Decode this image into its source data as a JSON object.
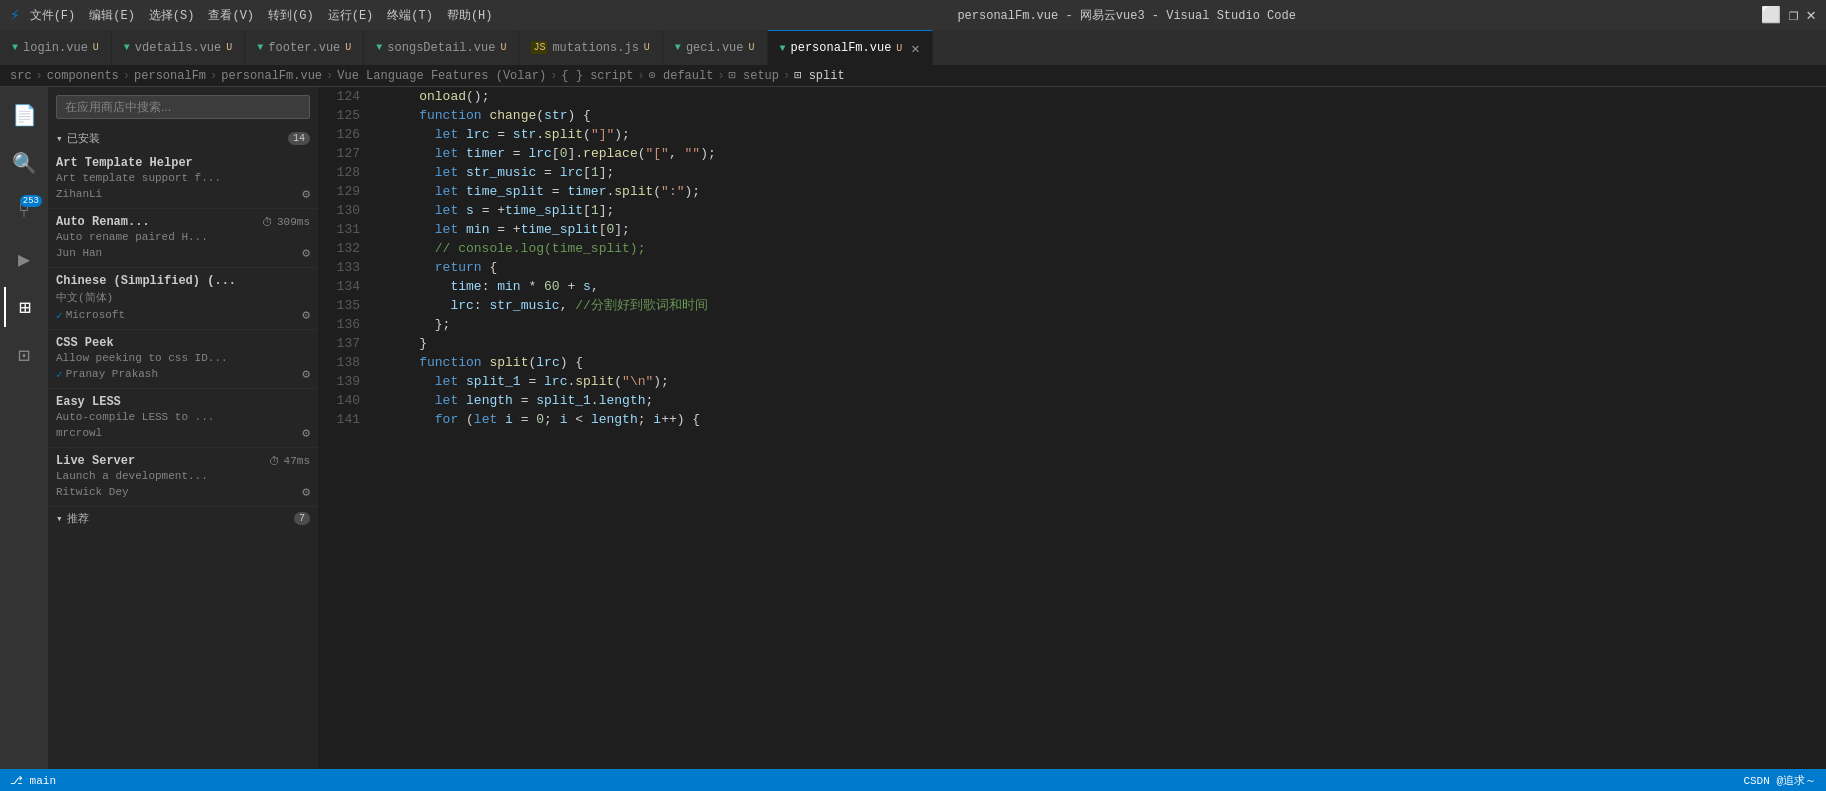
{
  "titleBar": {
    "logo": "⚡",
    "menus": [
      "文件(F)",
      "编辑(E)",
      "选择(S)",
      "查看(V)",
      "转到(G)",
      "运行(E)",
      "终端(T)",
      "帮助(H)"
    ],
    "title": "personalFm.vue - 网易云vue3 - Visual Studio Code",
    "windowControls": [
      "⬜",
      "❐",
      "✕"
    ]
  },
  "tabs": [
    {
      "id": "login",
      "label": "login.vue",
      "icon": "vue",
      "modified": true,
      "active": false
    },
    {
      "id": "vdetails",
      "label": "vdetails.vue",
      "icon": "vue",
      "modified": true,
      "active": false
    },
    {
      "id": "footer",
      "label": "footer.vue",
      "icon": "vue",
      "modified": true,
      "active": false
    },
    {
      "id": "songsDetail",
      "label": "songsDetail.vue",
      "icon": "vue",
      "modified": true,
      "active": false
    },
    {
      "id": "mutations",
      "label": "mutations.js",
      "icon": "js",
      "modified": true,
      "active": false
    },
    {
      "id": "geci",
      "label": "geci.vue",
      "icon": "vue",
      "modified": true,
      "active": false
    },
    {
      "id": "personalfm",
      "label": "personalFm.vue",
      "icon": "vue",
      "modified": true,
      "active": true
    }
  ],
  "breadcrumb": {
    "parts": [
      "src",
      "components",
      "personalFm",
      "personalFm.vue",
      "Vue Language Features (Volar)",
      "{ } script",
      "⊙ default",
      "⊡ setup",
      "⊡ split"
    ]
  },
  "sidebar": {
    "searchPlaceholder": "在应用商店中搜索...",
    "installedSection": {
      "label": "已安装",
      "count": "14"
    },
    "extensions": [
      {
        "id": "art-template",
        "name": "Art Template Helper",
        "desc": "Art template support f...",
        "author": "ZihanLi",
        "verified": false,
        "hasGear": true,
        "timer": null,
        "timerVal": null
      },
      {
        "id": "auto-rename",
        "name": "Auto Renam...",
        "desc": "Auto rename paired H...",
        "author": "Jun Han",
        "verified": false,
        "hasGear": true,
        "timer": true,
        "timerVal": "309ms"
      },
      {
        "id": "chinese",
        "name": "Chinese (Simplified) (...",
        "desc": "中文(简体)",
        "author": "Microsoft",
        "verified": true,
        "hasGear": true,
        "timer": null,
        "timerVal": null
      },
      {
        "id": "css-peek",
        "name": "CSS Peek",
        "desc": "Allow peeking to css ID...",
        "author": "Pranay Prakash",
        "verified": true,
        "hasGear": true,
        "timer": null,
        "timerVal": null
      },
      {
        "id": "easy-less",
        "name": "Easy LESS",
        "desc": "Auto-compile LESS to ...",
        "author": "mrcrowl",
        "verified": false,
        "hasGear": true,
        "timer": null,
        "timerVal": null
      },
      {
        "id": "live-server",
        "name": "Live Server",
        "desc": "Launch a development...",
        "author": "Ritwick Dey",
        "verified": false,
        "hasGear": true,
        "timer": true,
        "timerVal": "47ms"
      }
    ],
    "recommendedSection": {
      "label": "推荐",
      "count": "7"
    }
  },
  "codeLines": [
    {
      "num": "124",
      "tokens": [
        {
          "t": "plain",
          "v": "    "
        },
        {
          "t": "fn",
          "v": "onload"
        },
        {
          "t": "punc",
          "v": "();"
        }
      ]
    },
    {
      "num": "125",
      "tokens": [
        {
          "t": "plain",
          "v": "    "
        },
        {
          "t": "kw",
          "v": "function"
        },
        {
          "t": "plain",
          "v": " "
        },
        {
          "t": "fn",
          "v": "change"
        },
        {
          "t": "punc",
          "v": "("
        },
        {
          "t": "param",
          "v": "str"
        },
        {
          "t": "punc",
          "v": ") {"
        }
      ]
    },
    {
      "num": "126",
      "tokens": [
        {
          "t": "plain",
          "v": "      "
        },
        {
          "t": "kw",
          "v": "let"
        },
        {
          "t": "plain",
          "v": " "
        },
        {
          "t": "var",
          "v": "lrc"
        },
        {
          "t": "plain",
          "v": " = "
        },
        {
          "t": "var",
          "v": "str"
        },
        {
          "t": "punc",
          "v": "."
        },
        {
          "t": "method",
          "v": "split"
        },
        {
          "t": "punc",
          "v": "("
        },
        {
          "t": "str",
          "v": "\"]\""
        },
        {
          "t": "punc",
          "v": ");"
        }
      ]
    },
    {
      "num": "127",
      "tokens": [
        {
          "t": "plain",
          "v": "      "
        },
        {
          "t": "kw",
          "v": "let"
        },
        {
          "t": "plain",
          "v": " "
        },
        {
          "t": "var",
          "v": "timer"
        },
        {
          "t": "plain",
          "v": " = "
        },
        {
          "t": "var",
          "v": "lrc"
        },
        {
          "t": "punc",
          "v": "["
        },
        {
          "t": "num",
          "v": "0"
        },
        {
          "t": "punc",
          "v": "]."
        },
        {
          "t": "method",
          "v": "replace"
        },
        {
          "t": "punc",
          "v": "("
        },
        {
          "t": "str",
          "v": "\"[\""
        },
        {
          "t": "punc",
          "v": ", "
        },
        {
          "t": "str",
          "v": "\"\""
        },
        {
          "t": "punc",
          "v": ");"
        }
      ]
    },
    {
      "num": "128",
      "tokens": [
        {
          "t": "plain",
          "v": "      "
        },
        {
          "t": "kw",
          "v": "let"
        },
        {
          "t": "plain",
          "v": " "
        },
        {
          "t": "var",
          "v": "str_music"
        },
        {
          "t": "plain",
          "v": " = "
        },
        {
          "t": "var",
          "v": "lrc"
        },
        {
          "t": "punc",
          "v": "["
        },
        {
          "t": "num",
          "v": "1"
        },
        {
          "t": "punc",
          "v": "];"
        }
      ]
    },
    {
      "num": "129",
      "tokens": [
        {
          "t": "plain",
          "v": "      "
        },
        {
          "t": "kw",
          "v": "let"
        },
        {
          "t": "plain",
          "v": " "
        },
        {
          "t": "var",
          "v": "time_split"
        },
        {
          "t": "plain",
          "v": " = "
        },
        {
          "t": "var",
          "v": "timer"
        },
        {
          "t": "punc",
          "v": "."
        },
        {
          "t": "method",
          "v": "split"
        },
        {
          "t": "punc",
          "v": "("
        },
        {
          "t": "str",
          "v": "\":\""
        },
        {
          "t": "punc",
          "v": ");"
        }
      ]
    },
    {
      "num": "130",
      "tokens": [
        {
          "t": "plain",
          "v": "      "
        },
        {
          "t": "kw",
          "v": "let"
        },
        {
          "t": "plain",
          "v": " "
        },
        {
          "t": "var",
          "v": "s"
        },
        {
          "t": "plain",
          "v": " = +"
        },
        {
          "t": "var",
          "v": "time_split"
        },
        {
          "t": "punc",
          "v": "["
        },
        {
          "t": "num",
          "v": "1"
        },
        {
          "t": "punc",
          "v": "];"
        }
      ]
    },
    {
      "num": "131",
      "tokens": [
        {
          "t": "plain",
          "v": "      "
        },
        {
          "t": "kw",
          "v": "let"
        },
        {
          "t": "plain",
          "v": " "
        },
        {
          "t": "var",
          "v": "min"
        },
        {
          "t": "plain",
          "v": " = +"
        },
        {
          "t": "var",
          "v": "time_split"
        },
        {
          "t": "punc",
          "v": "["
        },
        {
          "t": "num",
          "v": "0"
        },
        {
          "t": "punc",
          "v": "];"
        }
      ]
    },
    {
      "num": "132",
      "tokens": [
        {
          "t": "comment",
          "v": "      // console.log(time_split);"
        }
      ]
    },
    {
      "num": "133",
      "tokens": [
        {
          "t": "plain",
          "v": "      "
        },
        {
          "t": "kw",
          "v": "return"
        },
        {
          "t": "plain",
          "v": " {"
        }
      ]
    },
    {
      "num": "134",
      "tokens": [
        {
          "t": "plain",
          "v": "        "
        },
        {
          "t": "prop",
          "v": "time"
        },
        {
          "t": "punc",
          "v": ": "
        },
        {
          "t": "var",
          "v": "min"
        },
        {
          "t": "plain",
          "v": " * "
        },
        {
          "t": "num",
          "v": "60"
        },
        {
          "t": "plain",
          "v": " + "
        },
        {
          "t": "var",
          "v": "s"
        },
        {
          "t": "punc",
          "v": ","
        }
      ]
    },
    {
      "num": "135",
      "tokens": [
        {
          "t": "plain",
          "v": "        "
        },
        {
          "t": "prop",
          "v": "lrc"
        },
        {
          "t": "punc",
          "v": ": "
        },
        {
          "t": "var",
          "v": "str_music"
        },
        {
          "t": "punc",
          "v": ", "
        },
        {
          "t": "comment",
          "v": "//分割好到歌词和时间"
        }
      ]
    },
    {
      "num": "136",
      "tokens": [
        {
          "t": "plain",
          "v": "      };"
        }
      ]
    },
    {
      "num": "137",
      "tokens": [
        {
          "t": "plain",
          "v": "    }"
        }
      ]
    },
    {
      "num": "138",
      "tokens": [
        {
          "t": "plain",
          "v": "    "
        },
        {
          "t": "kw",
          "v": "function"
        },
        {
          "t": "plain",
          "v": " "
        },
        {
          "t": "fn",
          "v": "split"
        },
        {
          "t": "punc",
          "v": "("
        },
        {
          "t": "param",
          "v": "lrc"
        },
        {
          "t": "punc",
          "v": ") {"
        }
      ]
    },
    {
      "num": "139",
      "tokens": [
        {
          "t": "plain",
          "v": "      "
        },
        {
          "t": "kw",
          "v": "let"
        },
        {
          "t": "plain",
          "v": " "
        },
        {
          "t": "var",
          "v": "split_1"
        },
        {
          "t": "plain",
          "v": " = "
        },
        {
          "t": "var",
          "v": "lrc"
        },
        {
          "t": "punc",
          "v": "."
        },
        {
          "t": "method",
          "v": "split"
        },
        {
          "t": "punc",
          "v": "("
        },
        {
          "t": "str",
          "v": "\"\\n\""
        },
        {
          "t": "punc",
          "v": ");"
        }
      ]
    },
    {
      "num": "140",
      "tokens": [
        {
          "t": "plain",
          "v": "      "
        },
        {
          "t": "kw",
          "v": "let"
        },
        {
          "t": "plain",
          "v": " "
        },
        {
          "t": "var",
          "v": "length"
        },
        {
          "t": "plain",
          "v": " = "
        },
        {
          "t": "var",
          "v": "split_1"
        },
        {
          "t": "punc",
          "v": "."
        },
        {
          "t": "prop",
          "v": "length"
        },
        {
          "t": "punc",
          "v": ";"
        }
      ]
    },
    {
      "num": "141",
      "tokens": [
        {
          "t": "plain",
          "v": "      "
        },
        {
          "t": "kw",
          "v": "for"
        },
        {
          "t": "punc",
          "v": " ("
        },
        {
          "t": "kw",
          "v": "let"
        },
        {
          "t": "plain",
          "v": " "
        },
        {
          "t": "var",
          "v": "i"
        },
        {
          "t": "plain",
          "v": " = "
        },
        {
          "t": "num",
          "v": "0"
        },
        {
          "t": "punc",
          "v": "; "
        },
        {
          "t": "var",
          "v": "i"
        },
        {
          "t": "plain",
          "v": " < "
        },
        {
          "t": "var",
          "v": "length"
        },
        {
          "t": "punc",
          "v": "; "
        },
        {
          "t": "var",
          "v": "i"
        },
        {
          "t": "punc",
          "v": "++) {"
        }
      ]
    }
  ],
  "statusBar": {
    "left": [
      "⎇ main"
    ],
    "right": [
      "CSDN @追求～"
    ]
  },
  "activityItems": [
    {
      "id": "explorer",
      "icon": "📄",
      "active": false
    },
    {
      "id": "search",
      "icon": "🔍",
      "active": false
    },
    {
      "id": "source-control",
      "icon": "⑂",
      "active": false,
      "badge": "253"
    },
    {
      "id": "run",
      "icon": "▶",
      "active": false
    },
    {
      "id": "extensions",
      "icon": "⊞",
      "active": true
    },
    {
      "id": "remote",
      "icon": "⊡",
      "active": false
    }
  ]
}
